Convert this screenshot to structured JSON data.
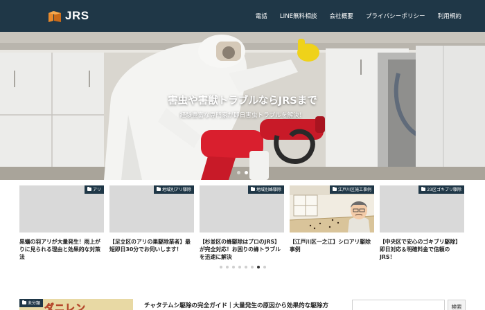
{
  "header": {
    "logo_text": "JRS",
    "nav": [
      {
        "label": "電話"
      },
      {
        "label": "LINE無料相談"
      },
      {
        "label": "会社概要"
      },
      {
        "label": "プライバシーポリシー"
      },
      {
        "label": "利用規約"
      }
    ]
  },
  "hero": {
    "title": "害虫や害獣トラブルならJRSまで",
    "subtitle": "経験豊富な専門家が即日害虫トラブルを解決！",
    "slide_count": 2,
    "active_slide": 1
  },
  "cards": [
    {
      "tag": "アリ",
      "title": "黒蟻の羽アリが大量発生！雨上がりに見られる理由と効果的な対策法",
      "has_image": false
    },
    {
      "tag": "地域別アリ駆除",
      "title": "【足立区のアリの巣駆除業者】最短即日30分でお伺いします！",
      "has_image": false
    },
    {
      "tag": "地域別蜂駆除",
      "title": "【杉並区の蜂駆除はプロのJRS】が完全対応！お困りの蜂トラブルを迅速に解決",
      "has_image": false
    },
    {
      "tag": "江戸川区施工事例",
      "title": "【江戸川区一之江】シロアリ駆除事例",
      "has_image": true
    },
    {
      "tag": "23区ゴキブリ駆除",
      "title": "【中央区で安心のゴキブリ駆除】即日対応＆明確料金で信頼のJRS！",
      "has_image": false
    }
  ],
  "carousel": {
    "dot_count": 8,
    "active_dot": 6
  },
  "bottom": {
    "tag": "未分類",
    "thumb_text": "ダニレン",
    "title": "チャタテムシ駆除の完全ガイド｜大量発生の原因から効果的な駆除方",
    "search_placeholder": "",
    "search_button": "検索"
  },
  "colors": {
    "header": "#1f3747",
    "accent": "#d91f2e",
    "logo": "#e8892b"
  }
}
